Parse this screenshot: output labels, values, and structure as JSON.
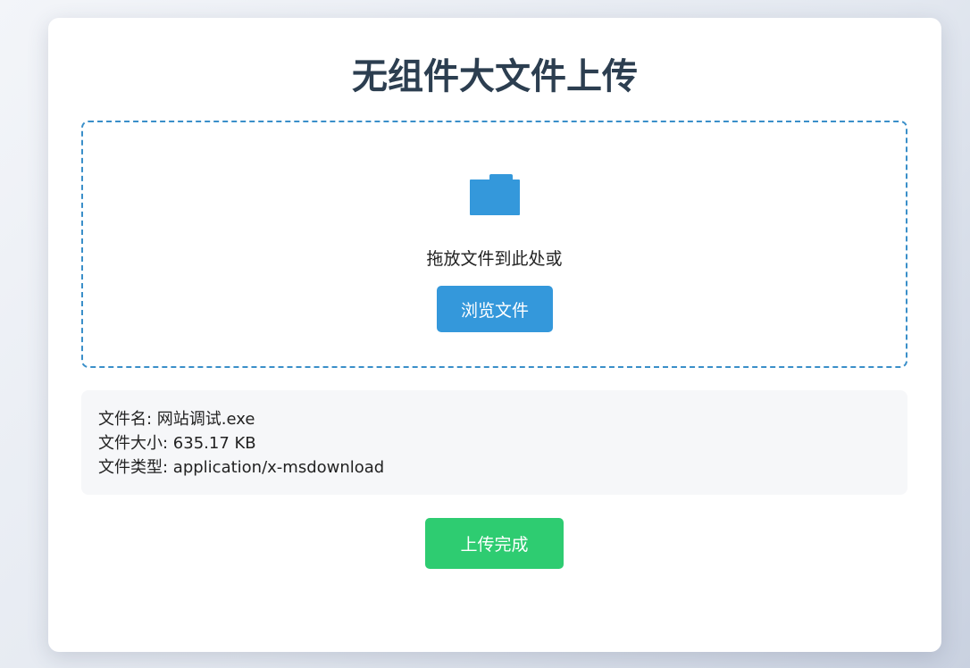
{
  "page": {
    "title": "无组件大文件上传"
  },
  "dropzone": {
    "icon": "folder-icon",
    "prompt_text": "拖放文件到此处或",
    "browse_label": "浏览文件"
  },
  "file_info": {
    "name_line": "文件名: 网站调试.exe",
    "size_line": "文件大小: 635.17 KB",
    "type_line": "文件类型: application/x-msdownload"
  },
  "upload": {
    "label": "上传完成"
  },
  "colors": {
    "accent_blue": "#3498db",
    "success_green": "#2ecc71",
    "title_text": "#2c3e50"
  }
}
